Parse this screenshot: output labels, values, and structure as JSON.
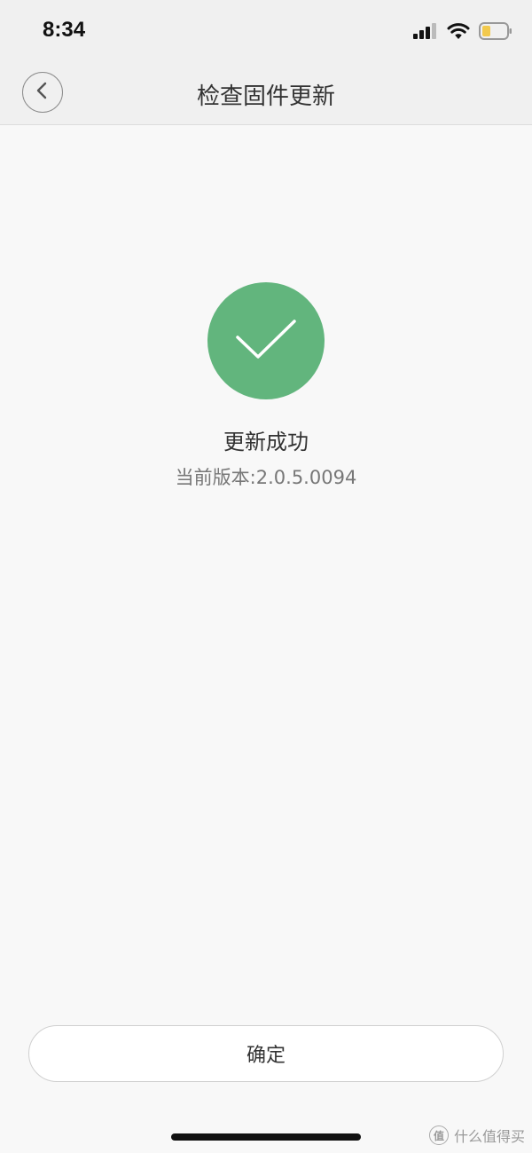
{
  "status_bar": {
    "time": "8:34",
    "icons": [
      "signal-icon",
      "wifi-icon",
      "battery-icon"
    ],
    "battery_color": "#f2c94c"
  },
  "nav": {
    "title": "检查固件更新",
    "back_icon": "chevron-left-icon"
  },
  "result": {
    "icon": "checkmark-icon",
    "icon_color": "#62b57d",
    "title": "更新成功",
    "version_label": "当前版本:",
    "version_value": "2.0.5.0094"
  },
  "footer": {
    "confirm_label": "确定"
  },
  "watermark": {
    "badge": "值",
    "text": "什么值得买"
  }
}
